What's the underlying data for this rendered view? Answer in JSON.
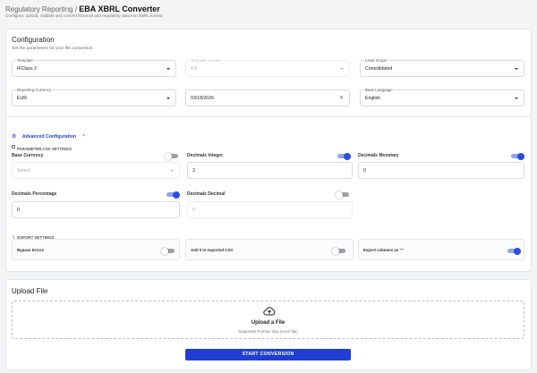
{
  "header": {
    "breadcrumb_parent": "Regulatory Reporting",
    "breadcrumb_sep": " / ",
    "title": "EBA XBRL Converter",
    "subtitle": "Configure, upload, validate and convert financial and regulatory data into XBRL format."
  },
  "configuration": {
    "title": "Configuration",
    "hint": "Set the parameters for your file conversion",
    "template": {
      "label": "Template",
      "value": "IFClass 2"
    },
    "template_version": {
      "label": "Template Version",
      "value": "4.0"
    },
    "level_scope": {
      "label": "Level Scope",
      "value": "Consolidated"
    },
    "reporting_currency": {
      "label": "Reporting Currency",
      "value": "EUR"
    },
    "reference_date": {
      "value": "03/18/2026",
      "clear_icon": "close-icon"
    },
    "base_language": {
      "label": "Base Language",
      "value": "English"
    }
  },
  "advanced": {
    "label": "Advanced Configuration",
    "icon": "chevron-up-icon",
    "parameter_section": "PARAMETER.CSV SETTINGS",
    "base_currency": {
      "label": "Base Currency",
      "placeholder": "Select",
      "enabled": false
    },
    "decimals_integer": {
      "label": "Decimals Integer",
      "value": "3",
      "enabled": true
    },
    "decimals_monetary": {
      "label": "Decimals Monetary",
      "value": "0",
      "enabled": true
    },
    "decimals_percentage": {
      "label": "Decimals Percentage",
      "value": "0",
      "enabled": true
    },
    "decimals_decimal": {
      "label": "Decimals Decimal",
      "value": "0",
      "enabled": false
    },
    "export_section": "EXPORT SETTINGS",
    "bypass_errors": {
      "label": "Bypass Errors",
      "enabled": false
    },
    "add_zero": {
      "label": "Add 0 in exported CSV",
      "enabled": false
    },
    "export_columns": {
      "label": "Export columns as \"\"",
      "enabled": true
    }
  },
  "upload": {
    "title": "Upload File",
    "drop_title": "Upload a File",
    "drop_hint": "Supported Format: xlsx (excel file)",
    "icon": "cloud-upload-icon",
    "button": "START CONVERSION"
  },
  "colors": {
    "accent": "#1f3fd4",
    "background": "#f3f4f6",
    "card": "#ffffff"
  }
}
